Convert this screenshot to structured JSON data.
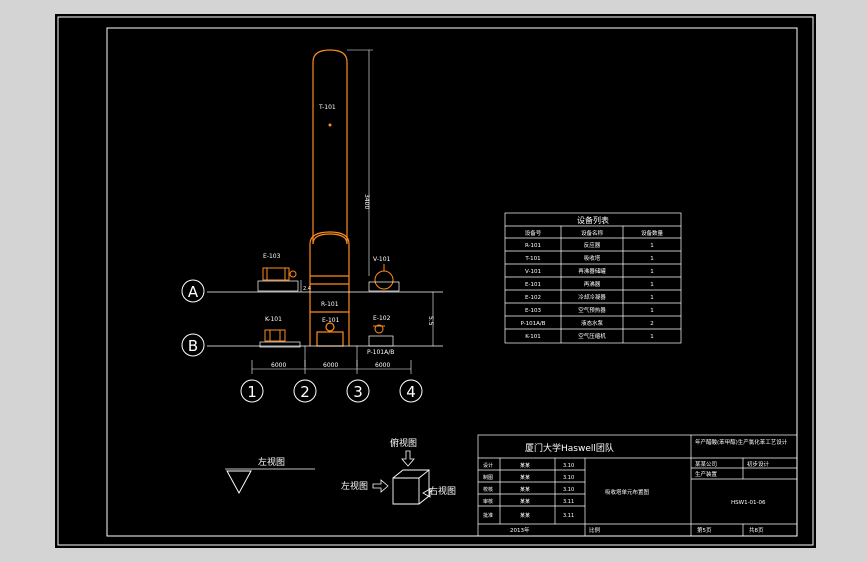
{
  "drawing": {
    "equipment_labels": {
      "tower_top": "T-101",
      "tower_bottom": "R-101",
      "e103": "E-103",
      "v101": "V-101",
      "k101": "K-101",
      "e102": "E-102",
      "e101": "E-101",
      "p101": "P-101A/B"
    },
    "dims": {
      "tower_height": "3400",
      "elev_upper": "5.5",
      "elev_lower": "2.4",
      "span": "6000"
    },
    "axis_rows": [
      "A",
      "B"
    ],
    "axis_cols": [
      "1",
      "2",
      "3",
      "4"
    ]
  },
  "equipment_table": {
    "title": "设备列表",
    "headers": [
      "设备号",
      "设备名称",
      "设备数量"
    ],
    "rows": [
      [
        "R-101",
        "反应器",
        "1"
      ],
      [
        "T-101",
        "吸收塔",
        "1"
      ],
      [
        "V-101",
        "再沸器储罐",
        "1"
      ],
      [
        "E-101",
        "再沸器",
        "1"
      ],
      [
        "E-102",
        "冷却冷凝器",
        "1"
      ],
      [
        "E-103",
        "空气预热器",
        "1"
      ],
      [
        "P-101A/B",
        "液态水泵",
        "2"
      ],
      [
        "K-101",
        "空气压缩机",
        "1"
      ]
    ]
  },
  "views": {
    "left_view_symbol_label": "左视图",
    "top_view": "俯视图",
    "left_view": "左视图",
    "right_view": "右视图"
  },
  "title_block": {
    "team": "厦门大学Haswell团队",
    "project": "年产醋酸(苯甲醇)生产氯化苯工艺设计",
    "drawing_name": "吸收塔单元布置图",
    "company": "某某公司",
    "stage": "初步设计",
    "dept": "生产装置",
    "drawing_no": "HSW1-01-06",
    "year": "2013年",
    "scale": "比例",
    "sheet": "第5页",
    "total": "共8页",
    "roles": [
      "设计",
      "制图",
      "校核",
      "审核",
      "批准"
    ],
    "names": [
      "某某",
      "某某",
      "某某",
      "某某",
      "某某"
    ],
    "dates": [
      "3.10",
      "3.10",
      "3.10",
      "3.11",
      "3.11"
    ]
  }
}
